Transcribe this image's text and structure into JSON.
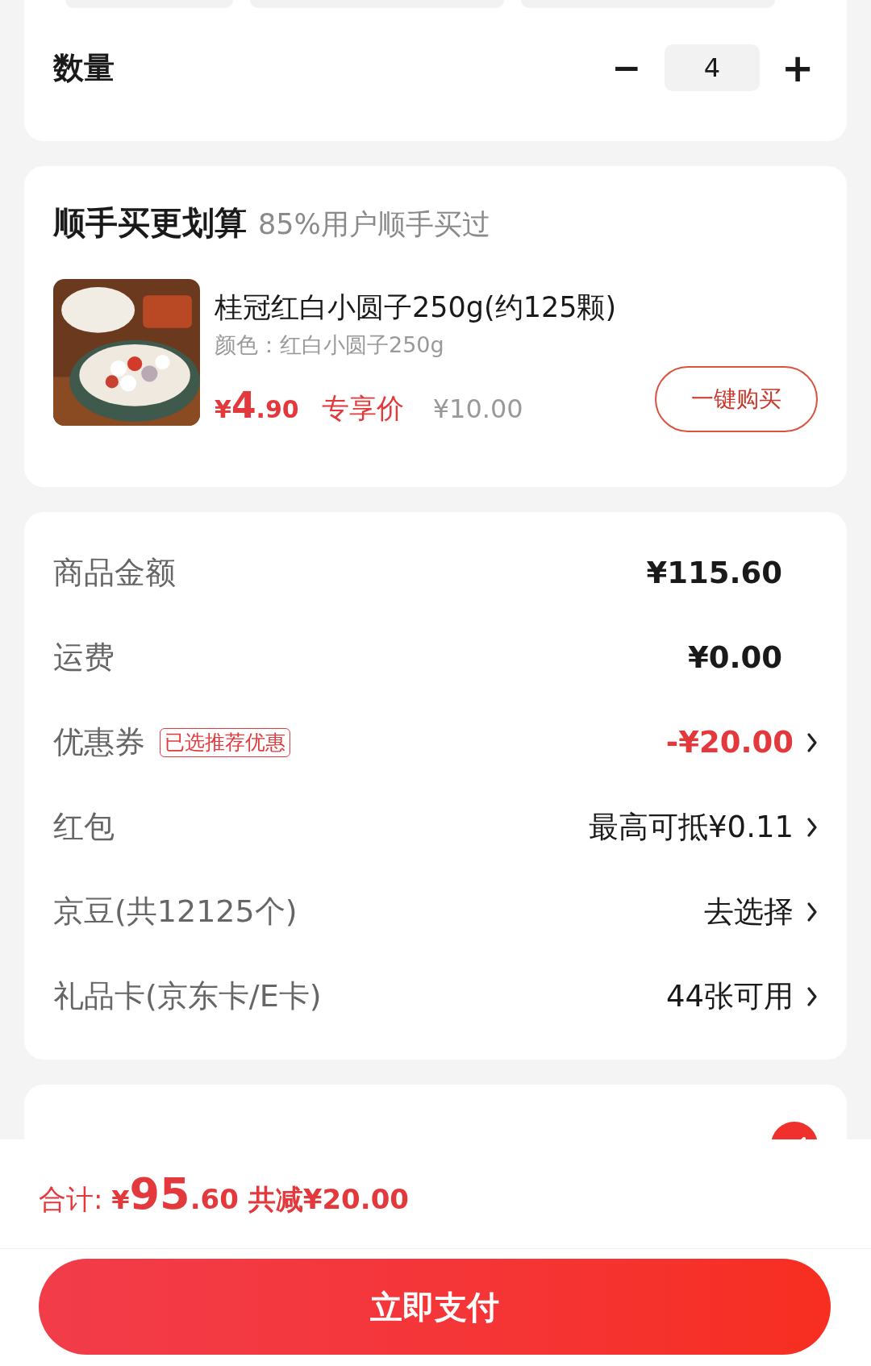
{
  "quantity": {
    "label": "数量",
    "minus": "−",
    "value": "4",
    "plus": "+"
  },
  "addon": {
    "title": "顺手买更划算",
    "subtitle": "85%用户顺手买过",
    "product": {
      "kind": "picture",
      "name": "桂冠红白小圆子250g(约125颗)",
      "spec": "颜色：红白小圆子250g",
      "price_symbol": "¥",
      "price_int": "4",
      "price_dec": ".90",
      "price_tag": "专享价",
      "original_price": "¥10.00",
      "button": "一键购买"
    }
  },
  "summary": [
    {
      "label": "商品金额",
      "value": "¥115.60",
      "kind": "amount",
      "arrow": false
    },
    {
      "label": "运费",
      "value": "¥0.00",
      "kind": "amount",
      "arrow": false
    },
    {
      "label": "优惠券",
      "badge": "已选推荐优惠",
      "value": "-¥20.00",
      "kind": "discount",
      "arrow": true
    },
    {
      "label": "红包",
      "value": "最高可抵¥0.11",
      "kind": "option",
      "arrow": true
    },
    {
      "label": "京豆(共12125个)",
      "value": "去选择",
      "kind": "option",
      "arrow": true
    },
    {
      "label": "礼品卡(京东卡/E卡)",
      "value": "44张可用",
      "kind": "option",
      "arrow": true
    }
  ],
  "payment": {
    "checked": true
  },
  "footer": {
    "total_label": "合计:",
    "symbol": "¥",
    "int": "95",
    "dec": ".60",
    "saving": "共减¥20.00",
    "pay_button": "立即支付"
  }
}
